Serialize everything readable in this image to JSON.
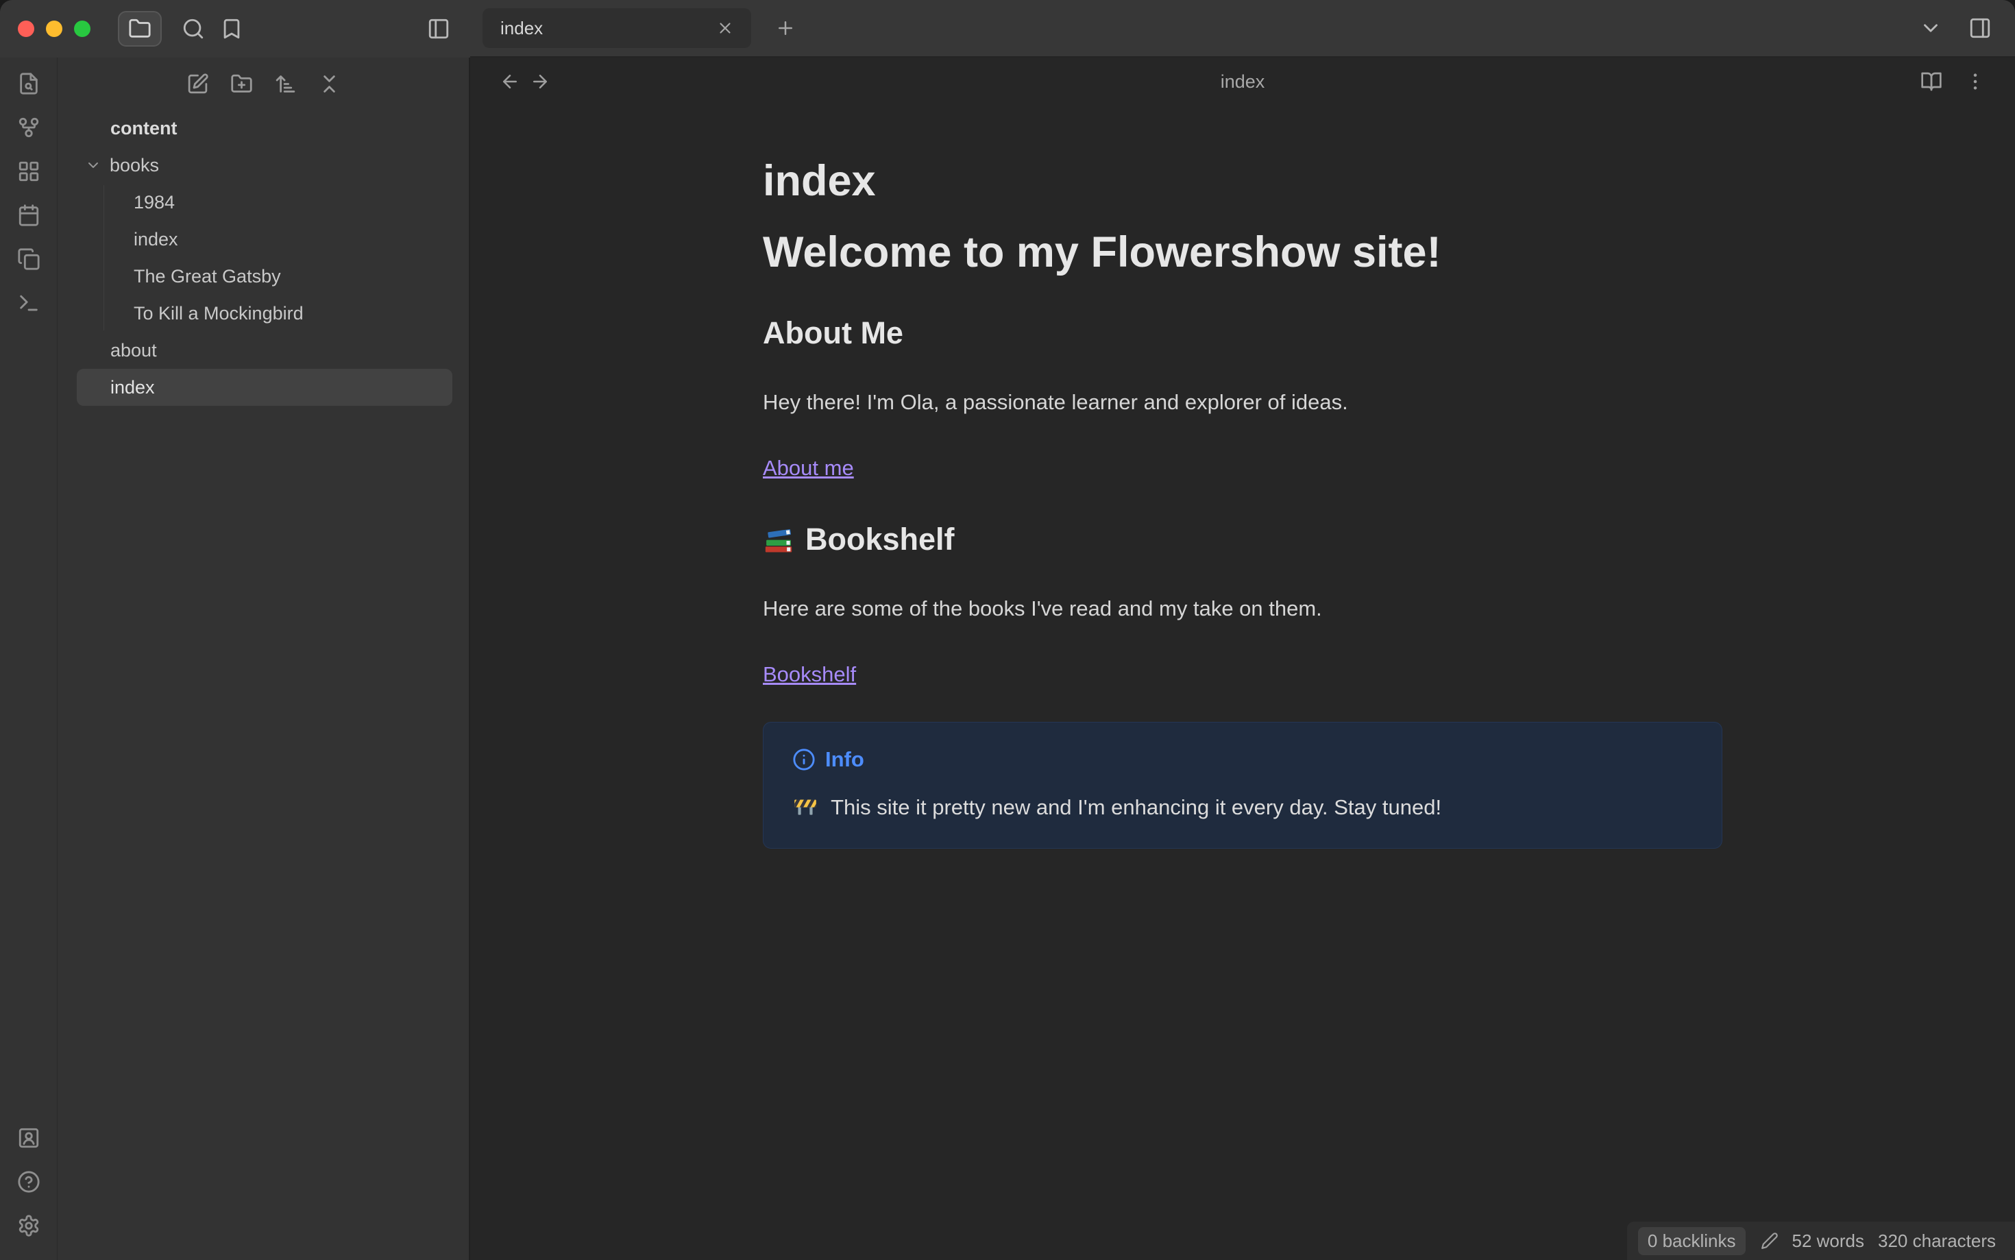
{
  "titlebar": {
    "tab": {
      "label": "index"
    },
    "left_icons": [
      "folder",
      "search",
      "bookmark",
      "panel-left"
    ],
    "right_icons": [
      "chevron-down",
      "panel-right"
    ],
    "tab_action_icons": [
      "close",
      "new-tab"
    ]
  },
  "ribbon": {
    "top_icons": [
      "file-search",
      "graph",
      "canvas",
      "calendar",
      "templates",
      "terminal"
    ],
    "bottom_icons": [
      "vault",
      "help",
      "settings"
    ]
  },
  "explorer": {
    "toolbar_icons": [
      "new-note",
      "new-folder",
      "sort-order",
      "collapse-all"
    ],
    "root": "content",
    "folders": [
      {
        "name": "books",
        "expanded": true,
        "children": [
          "1984",
          "index",
          "The Great Gatsby",
          "To Kill a Mockingbird"
        ]
      }
    ],
    "files": [
      {
        "name": "about",
        "selected": false
      },
      {
        "name": "index",
        "selected": true
      }
    ]
  },
  "editor": {
    "header": {
      "title": "index",
      "icons": [
        "back",
        "forward",
        "reading-view",
        "more-options"
      ]
    },
    "document": {
      "title_h1": "index",
      "welcome_h1": "Welcome to my Flowershow site!",
      "about_h2": "About Me",
      "about_text": "Hey there! I'm Ola, a passionate learner and explorer of ideas.",
      "about_link": "About me",
      "bookshelf_emoji": "📚",
      "bookshelf_h2": "Bookshelf",
      "bookshelf_text": "Here are some of the books I've read and my take on them.",
      "bookshelf_link": "Bookshelf",
      "callout": {
        "type": "info",
        "title": "Info",
        "body_emoji": "🚧",
        "body": "This site it pretty new and I'm enhancing it every day. Stay tuned!"
      }
    }
  },
  "statusbar": {
    "backlinks": "0 backlinks",
    "words": "52 words",
    "characters": "320 characters"
  },
  "colors": {
    "accent_link": "#a78bfa",
    "callout_title": "#4d8dff",
    "callout_bg": "#1f2b3e",
    "traffic_red": "#ff5f57",
    "traffic_yellow": "#febc2e",
    "traffic_green": "#28c840",
    "selection_bg": "#424242"
  }
}
